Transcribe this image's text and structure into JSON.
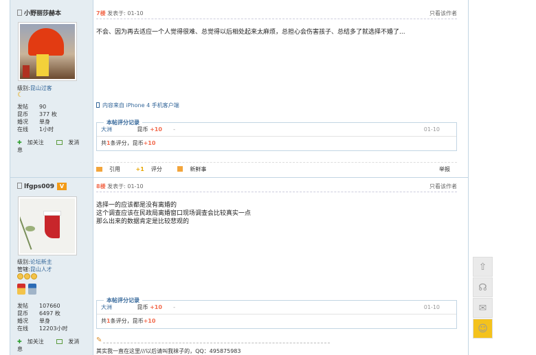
{
  "posts": [
    {
      "username": "小野丽莎赫本",
      "level_label": "级别:",
      "level": "昆山过客",
      "stats": [
        {
          "k": "发帖",
          "v": "90"
        },
        {
          "k": "昆币",
          "v": "377 枚"
        },
        {
          "k": "婚况",
          "v": "单身"
        },
        {
          "k": "在线",
          "v": "1小时"
        }
      ],
      "follow": "加关注",
      "message": "发消息",
      "floor": "7楼",
      "posted_prefix": "发表于:",
      "posted_time": "01-10",
      "only_author": "只看该作者",
      "content_lines": [
        "不会、因为再去适应一个人觉得很难、总觉得以后相处起来太麻烦，总担心会伤害孩子、总结多了就选择不婚了..."
      ],
      "source": "内容来自 iPhone 4 手机客户端",
      "rate_title": "本帖评分记录",
      "rate_user": "大洲",
      "rate_type": "昆币",
      "rate_value": "+10",
      "rate_dash": "-",
      "rate_date": "01-10",
      "rate_sum_prefix": "共",
      "rate_sum_count": "1",
      "rate_sum_mid": "条评分，昆币",
      "rate_sum_value": "+10",
      "footer": {
        "quote": "引用",
        "plus": "+1",
        "rate": "评分",
        "news": "新鲜事",
        "report": "举报"
      }
    },
    {
      "username": "lfgps009",
      "vip": "V",
      "level_label": "级别:",
      "level": "论坛新主",
      "medal_label": "管辖:",
      "medal": "昆山人才",
      "stats": [
        {
          "k": "发帖",
          "v": "107660"
        },
        {
          "k": "昆币",
          "v": "6497 枚"
        },
        {
          "k": "婚况",
          "v": "单身"
        },
        {
          "k": "在线",
          "v": "12203小时"
        }
      ],
      "follow": "加关注",
      "message": "发消息",
      "floor": "8楼",
      "posted_prefix": "发表于:",
      "posted_time": "01-10",
      "only_author": "只看该作者",
      "content_lines": [
        "选择一的应该都是没有离婚的",
        "这个调查应该在民政局离婚窗口现场调查会比较真实一点",
        "那么出来的数据肯定是比较悲观的"
      ],
      "rate_title": "本帖评分记录",
      "rate_user": "大洲",
      "rate_type": "昆币",
      "rate_value": "+10",
      "rate_dash": "-",
      "rate_date": "01-10",
      "rate_sum_prefix": "共",
      "rate_sum_count": "1",
      "rate_sum_mid": "条评分，昆币",
      "rate_sum_value": "+10",
      "signature": "其实我一直在这里///以后请叫我袜子的，QQ：495875983"
    }
  ],
  "right_tools": [
    {
      "icon": "arrow-up-icon",
      "glyph": "⇧"
    },
    {
      "icon": "headset-icon",
      "glyph": "☊"
    },
    {
      "icon": "wechat-icon",
      "glyph": "✉"
    },
    {
      "icon": "qq-icon",
      "glyph": "☺"
    }
  ],
  "colors": {
    "border": "#c2d5e3",
    "sidebar_bg": "#e5edf2",
    "floor": "#f26c4f",
    "link": "#336699"
  }
}
